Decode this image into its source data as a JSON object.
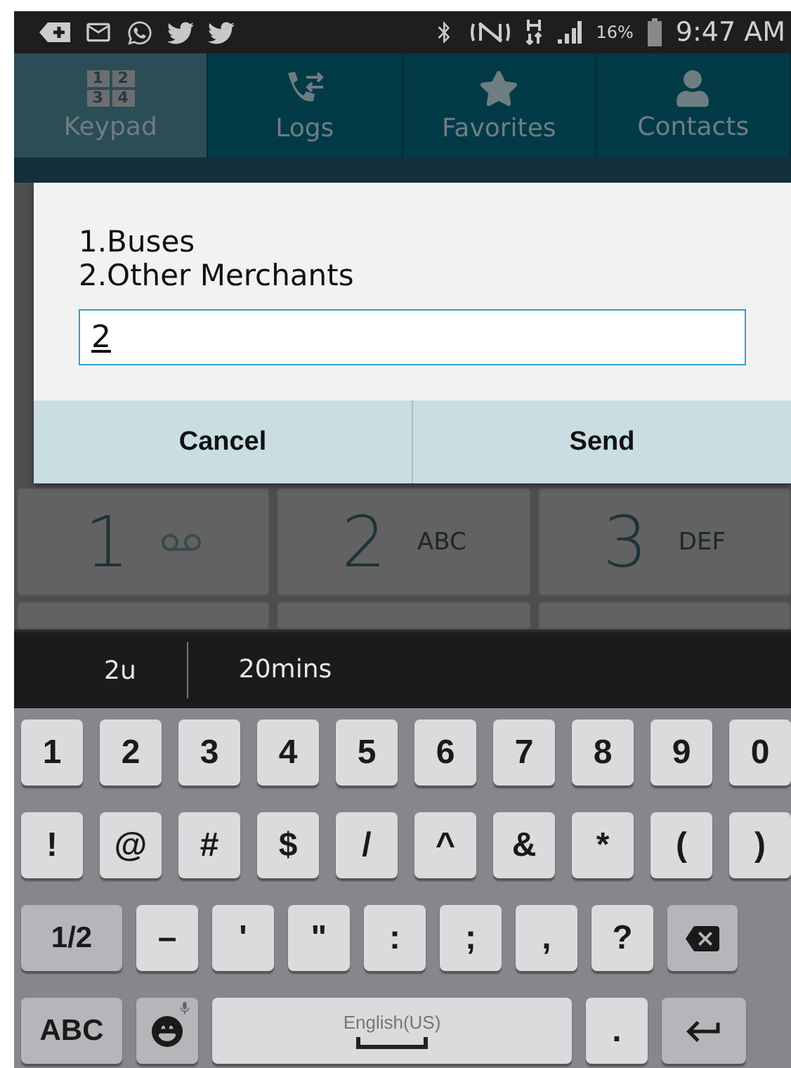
{
  "status_bar": {
    "battery": "16%",
    "time": "9:47 AM"
  },
  "tabs": [
    {
      "label": "Keypad",
      "selected": true
    },
    {
      "label": "Logs",
      "selected": false
    },
    {
      "label": "Favorites",
      "selected": false
    },
    {
      "label": "Contacts",
      "selected": false
    }
  ],
  "keypad_icon_digits": [
    "1",
    "2",
    "3",
    "4"
  ],
  "dialog": {
    "lines": [
      "1.Buses",
      "2.Other Merchants"
    ],
    "input_value": "2",
    "buttons": [
      "Cancel",
      "Send"
    ]
  },
  "dialer_keys": [
    {
      "digit": "1",
      "kind": "voicemail"
    },
    {
      "digit": "2",
      "kind": "letters",
      "letters": "ABC"
    },
    {
      "digit": "3",
      "kind": "letters",
      "letters": "DEF"
    }
  ],
  "suggestions": [
    "2u",
    "20mins"
  ],
  "keyboard_rows": [
    [
      {
        "kind": "char",
        "label": "1"
      },
      {
        "kind": "char",
        "label": "2"
      },
      {
        "kind": "char",
        "label": "3"
      },
      {
        "kind": "char",
        "label": "4"
      },
      {
        "kind": "char",
        "label": "5"
      },
      {
        "kind": "char",
        "label": "6"
      },
      {
        "kind": "char",
        "label": "7"
      },
      {
        "kind": "char",
        "label": "8"
      },
      {
        "kind": "char",
        "label": "9"
      },
      {
        "kind": "char",
        "label": "0"
      }
    ],
    [
      {
        "kind": "char",
        "label": "!"
      },
      {
        "kind": "char",
        "label": "@"
      },
      {
        "kind": "char",
        "label": "#"
      },
      {
        "kind": "char",
        "label": "$"
      },
      {
        "kind": "char",
        "label": "/"
      },
      {
        "kind": "char",
        "label": "^"
      },
      {
        "kind": "char",
        "label": "&"
      },
      {
        "kind": "char",
        "label": "*"
      },
      {
        "kind": "char",
        "label": "("
      },
      {
        "kind": "char",
        "label": ")"
      }
    ],
    [
      {
        "kind": "function",
        "label": "1/2"
      },
      {
        "kind": "char",
        "label": "–"
      },
      {
        "kind": "char",
        "label": "'"
      },
      {
        "kind": "char",
        "label": "\""
      },
      {
        "kind": "char",
        "label": ":"
      },
      {
        "kind": "char",
        "label": ";"
      },
      {
        "kind": "char",
        "label": ","
      },
      {
        "kind": "char",
        "label": "?"
      },
      {
        "kind": "backspace"
      }
    ],
    [
      {
        "kind": "function",
        "label": "ABC"
      },
      {
        "kind": "emoji"
      },
      {
        "kind": "space",
        "label": "English(US)"
      },
      {
        "kind": "period",
        "label": "."
      },
      {
        "kind": "enter"
      }
    ]
  ]
}
